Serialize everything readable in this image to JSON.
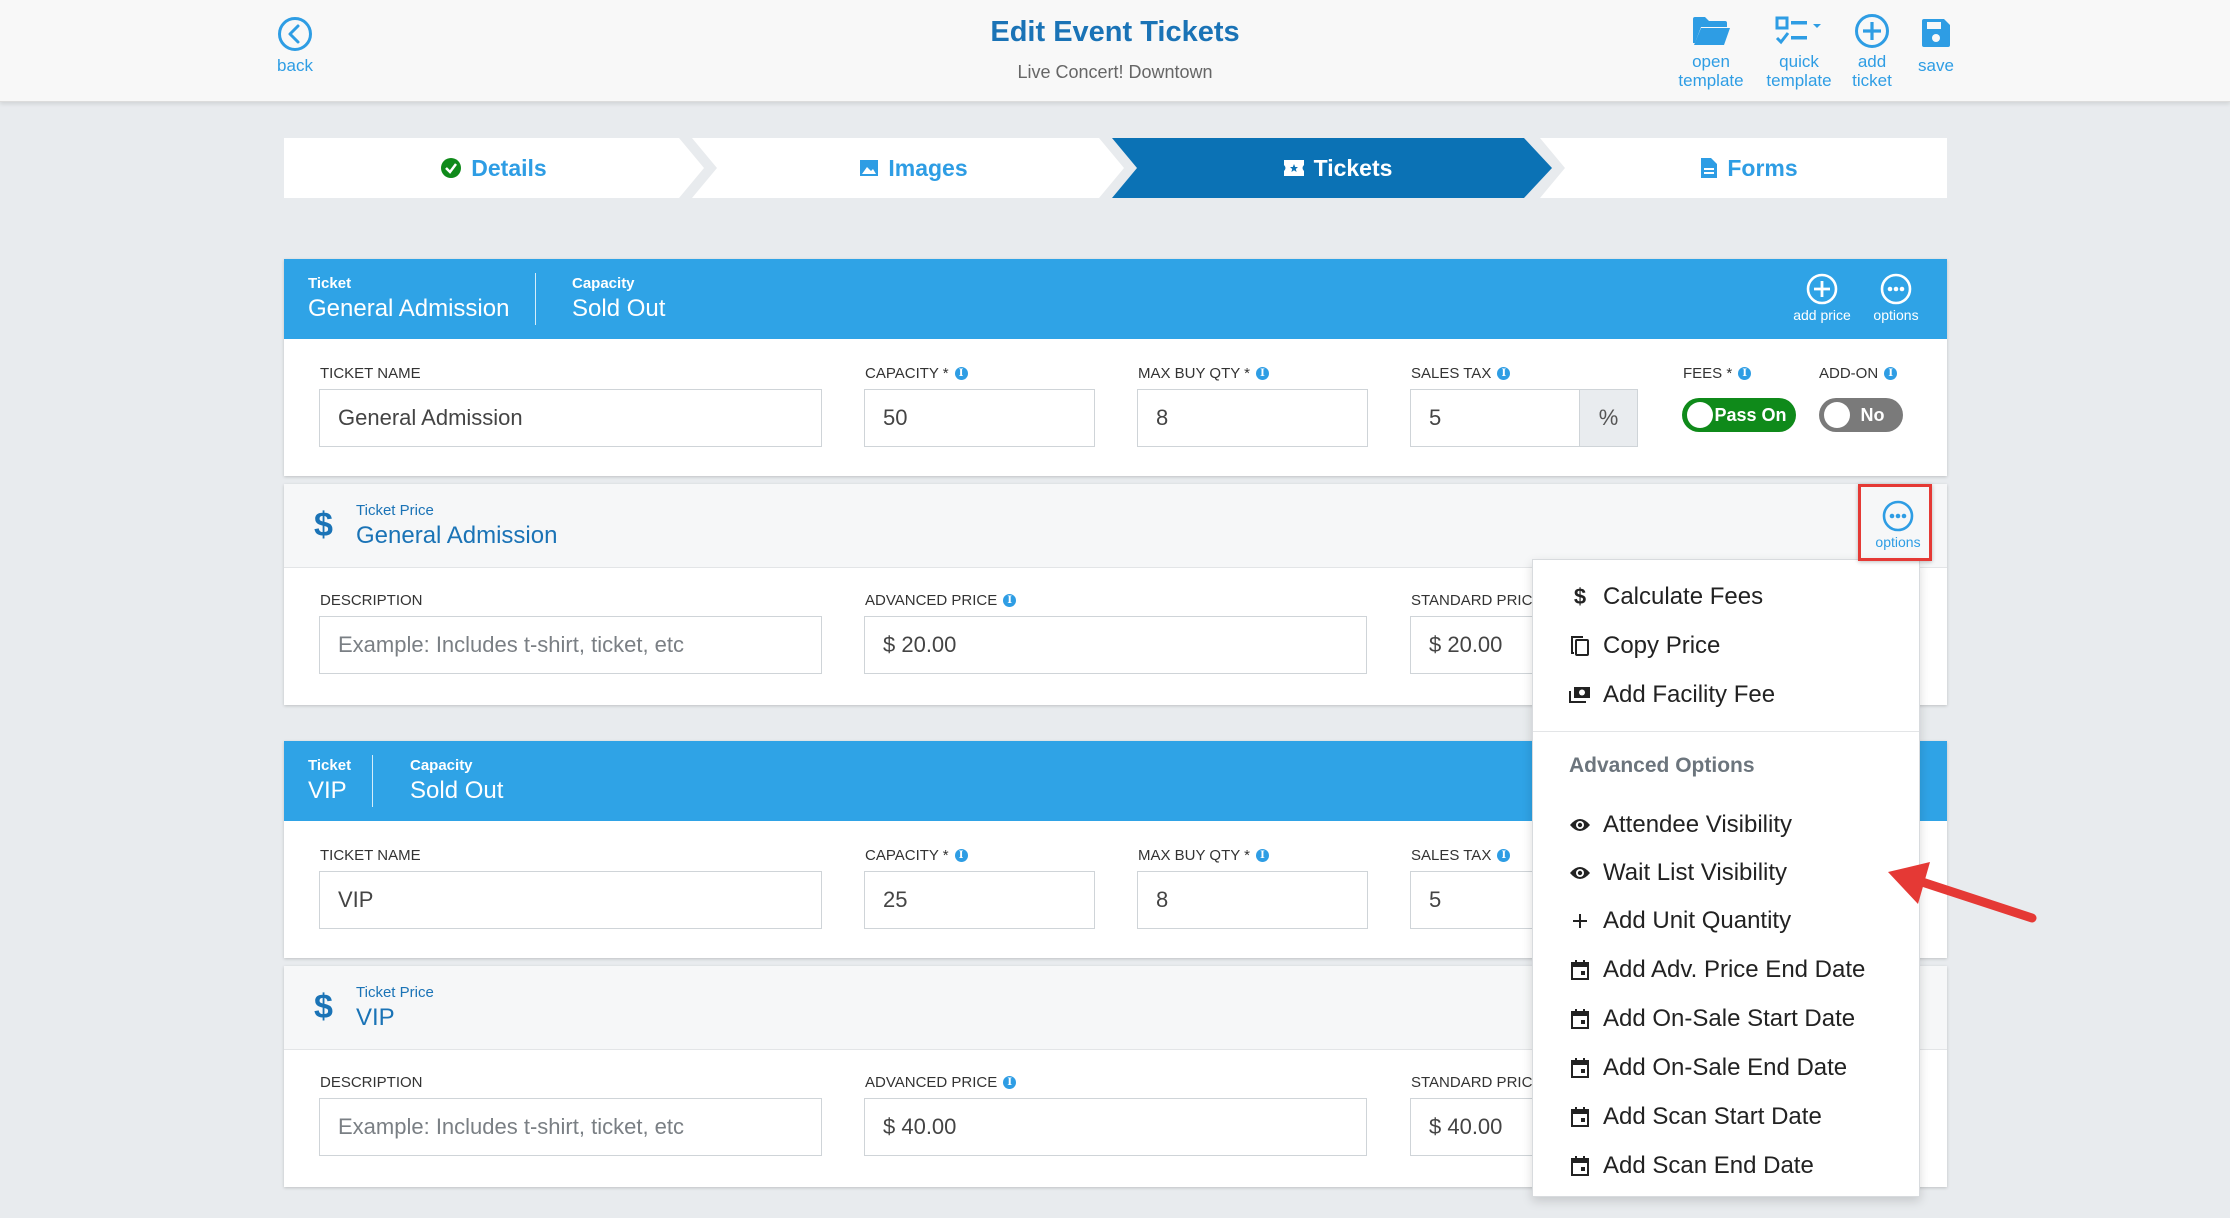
{
  "header": {
    "back_label": "back",
    "title": "Edit Event Tickets",
    "subtitle": "Live Concert! Downtown",
    "tools": [
      {
        "label_line1": "open",
        "label_line2": "template",
        "icon": "folder-open-icon"
      },
      {
        "label_line1": "quick",
        "label_line2": "template",
        "icon": "checklist-icon"
      },
      {
        "label_line1": "add",
        "label_line2": "ticket",
        "icon": "plus-circle-icon"
      },
      {
        "label_line1": "save",
        "label_line2": "",
        "icon": "floppy-disk-icon"
      }
    ]
  },
  "steps": [
    {
      "label": "Details",
      "icon": "check-circle-icon",
      "state": "complete"
    },
    {
      "label": "Images",
      "icon": "image-icon",
      "state": "default"
    },
    {
      "label": "Tickets",
      "icon": "ticket-icon",
      "state": "active"
    },
    {
      "label": "Forms",
      "icon": "document-icon",
      "state": "default"
    }
  ],
  "colors": {
    "primary": "#2fa3e6",
    "active_step": "#0b72b5",
    "title_blue": "#1a73b6",
    "toggle_on": "#0f8a1a",
    "toggle_off": "#7a7a7a",
    "highlight_red": "#e53935"
  },
  "tickets": [
    {
      "header": {
        "ticket_key": "Ticket",
        "ticket_value": "General Admission",
        "capacity_key": "Capacity",
        "capacity_value": "Sold Out",
        "add_price_label": "add price",
        "options_label": "options"
      },
      "fields": {
        "ticket_name_label": "TICKET NAME",
        "ticket_name": "General Admission",
        "capacity_label": "CAPACITY *",
        "capacity": "50",
        "max_buy_label": "MAX BUY QTY *",
        "max_buy": "8",
        "sales_tax_label": "SALES TAX",
        "sales_tax": "5",
        "sales_tax_unit": "%",
        "fees_label": "FEES *",
        "fees_toggle": "Pass On",
        "addon_label": "ADD-ON",
        "addon_toggle": "No"
      },
      "price": {
        "key": "Ticket Price",
        "name": "General Admission",
        "options_label": "options",
        "description_label": "DESCRIPTION",
        "description_placeholder": "Example: Includes t-shirt, ticket, etc",
        "advanced_label": "ADVANCED PRICE",
        "advanced_value": "$ 20.00",
        "standard_label": "STANDARD PRICE",
        "standard_value": "$ 20.00"
      }
    },
    {
      "header": {
        "ticket_key": "Ticket",
        "ticket_value": "VIP",
        "capacity_key": "Capacity",
        "capacity_value": "Sold Out"
      },
      "fields": {
        "ticket_name_label": "TICKET NAME",
        "ticket_name": "VIP",
        "capacity_label": "CAPACITY *",
        "capacity": "25",
        "max_buy_label": "MAX BUY QTY *",
        "max_buy": "8",
        "sales_tax_label": "SALES TAX",
        "sales_tax": "5"
      },
      "price": {
        "key": "Ticket Price",
        "name": "VIP",
        "description_label": "DESCRIPTION",
        "description_placeholder": "Example: Includes t-shirt, ticket, etc",
        "advanced_label": "ADVANCED PRICE",
        "advanced_value": "$ 40.00",
        "standard_label": "STANDARD PRICE",
        "standard_value": "$ 40.00"
      }
    }
  ],
  "options_menu": {
    "items": [
      {
        "label": "Calculate Fees",
        "icon": "dollar-icon"
      },
      {
        "label": "Copy Price",
        "icon": "copy-icon"
      },
      {
        "label": "Add Facility Fee",
        "icon": "money-icon"
      }
    ],
    "advanced_heading": "Advanced Options",
    "advanced_items": [
      {
        "label": "Attendee Visibility",
        "icon": "eye-icon"
      },
      {
        "label": "Wait List Visibility",
        "icon": "eye-icon"
      },
      {
        "label": "Add Unit Quantity",
        "icon": "plus-icon"
      },
      {
        "label": "Add Adv. Price End Date",
        "icon": "calendar-icon"
      },
      {
        "label": "Add On-Sale Start Date",
        "icon": "calendar-icon"
      },
      {
        "label": "Add On-Sale End Date",
        "icon": "calendar-icon"
      },
      {
        "label": "Add Scan Start Date",
        "icon": "calendar-icon"
      },
      {
        "label": "Add Scan End Date",
        "icon": "calendar-icon"
      }
    ]
  }
}
